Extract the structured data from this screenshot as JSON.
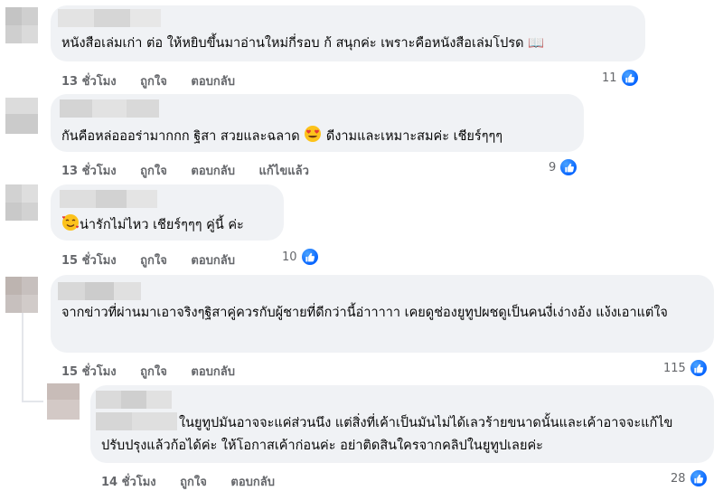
{
  "comments": [
    {
      "text": "หนังสือเล่มเก่า ต่อ ให้หยิบขึ้นมาอ่านใหม่กี่รอบ ก้ สนุกค่ะ เพราะคือหนังสือเล่มโปรด 📖",
      "time": "13 ชั่วโมง",
      "like": "ถูกใจ",
      "reply": "ตอบกลับ",
      "edited": "",
      "reactions": "11"
    },
    {
      "text_a": "กันคือหล่อออร่ามากกก ฐิสา สวยและฉลาด",
      "text_b": "ดีงามและเหมาะสมค่ะ เชียร์ๆๆๆ",
      "emoji": "heart-eyes",
      "time": "13 ชั่วโมง",
      "like": "ถูกใจ",
      "reply": "ตอบกลับ",
      "edited": "แก้ไขแล้ว",
      "reactions": "9"
    },
    {
      "emoji": "smiling-face-with-hearts",
      "text": "น่ารักไม่ไหว เชียร์ๆๆๆ คู่นี้ ค่ะ",
      "time": "15 ชั่วโมง",
      "like": "ถูกใจ",
      "reply": "ตอบกลับ",
      "reactions": "10"
    },
    {
      "text": "จากข่าวที่ผ่านมาเอาจริงๆฐิสาคู่ควรกับผู้ชายที่ดีกว่านี้อ่าาาาา เคยดูช่องยูทูปผชดูเป็นคนงี่เง่างอ้ง แง้งเอาแต่ใจ",
      "time": "15 ชั่วโมง",
      "like": "ถูกใจ",
      "reply": "ตอบกลับ",
      "reactions": "115"
    },
    {
      "text": "ในยูทูปมันอาจจะแค่ส่วนนึง แต่สิ่งที่เค้าเป็นมันไม่ได้เลวร้ายขนาดนั้นและเค้าอาจจะแก้ไขปรับปรุงแล้วก้อได้ค่ะ ให้โอกาสเค้าก่อนค่ะ อย่าติดสินใครจากคลิปในยูทูปเลยค่ะ",
      "time": "14 ชั่วโมง",
      "like": "ถูกใจ",
      "reply": "ตอบกลับ",
      "reactions": "28"
    }
  ],
  "colors": {
    "bubble": "#f0f2f5",
    "meta": "#65676b",
    "like_blue": "#0866ff"
  }
}
